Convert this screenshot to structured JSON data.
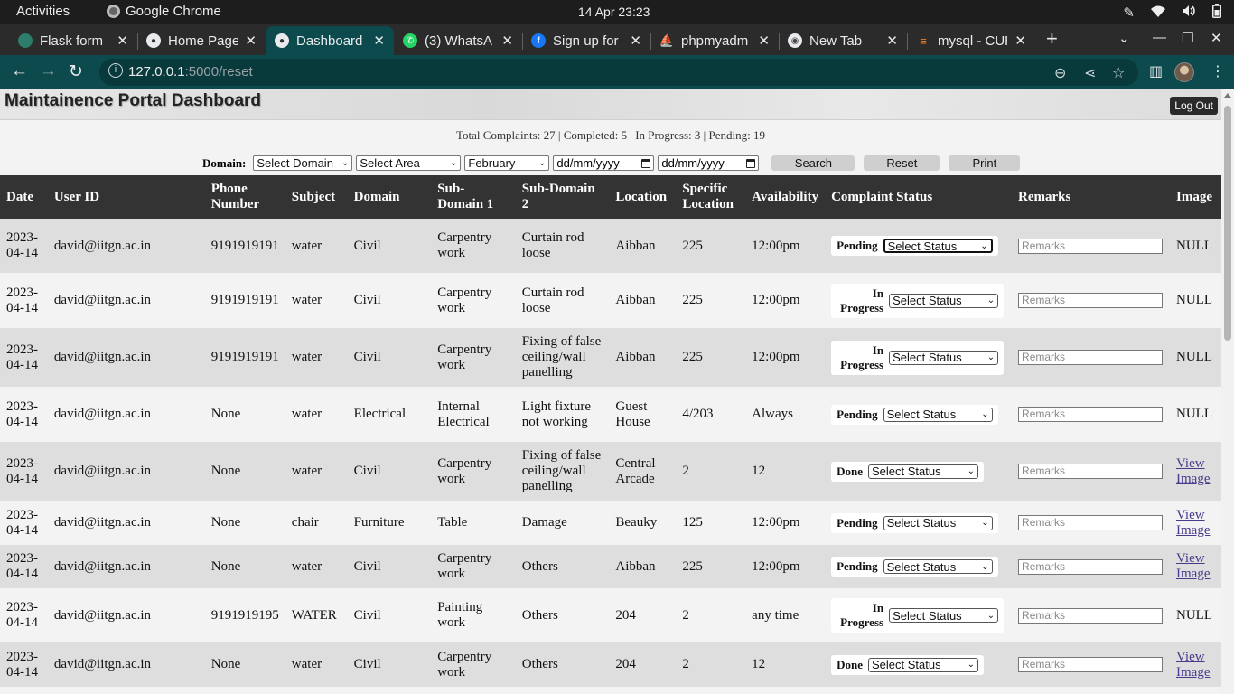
{
  "system": {
    "activities": "Activities",
    "app_name": "Google Chrome",
    "clock": "14 Apr  23:23"
  },
  "browser": {
    "tabs": [
      {
        "label": "Flask form",
        "icon": "flask-icon",
        "active": false
      },
      {
        "label": "Home Page",
        "icon": "globe-icon",
        "active": false
      },
      {
        "label": "Dashboard",
        "icon": "globe-icon",
        "active": true
      },
      {
        "label": "(3) WhatsA",
        "icon": "whatsapp-icon",
        "active": false
      },
      {
        "label": "Sign up for",
        "icon": "facebook-icon",
        "active": false
      },
      {
        "label": "phpmyadm",
        "icon": "phpmyadmin-icon",
        "active": false
      },
      {
        "label": "New Tab",
        "icon": "chrome-icon",
        "active": false
      },
      {
        "label": "mysql - CUR",
        "icon": "stackoverflow-icon",
        "active": false
      }
    ],
    "url_host": "127.0.0.1",
    "url_path": ":5000/reset"
  },
  "page": {
    "title": "Maintainence Portal Dashboard",
    "logout_label": "Log Out",
    "stats": "Total Complaints: 27 | Completed: 5 | In Progress: 3 | Pending: 19",
    "filters": {
      "label": "Domain:",
      "domain": "Select Domain",
      "area": "Select Area",
      "month": "February",
      "date_from": "dd/mm/yyyy",
      "date_to": "dd/mm/yyyy",
      "search_label": "Search",
      "reset_label": "Reset",
      "print_label": "Print"
    },
    "columns": [
      "Date",
      "User ID",
      "Phone Number",
      "Subject",
      "Domain",
      "Sub-Domain 1",
      "Sub-Domain 2",
      "Location",
      "Specific Location",
      "Availability",
      "Complaint Status",
      "Remarks",
      "Image"
    ],
    "status_select_placeholder": "Select Status",
    "remarks_placeholder": "Remarks",
    "view_image_label": "View Image",
    "rows": [
      {
        "date": "2023-04-14",
        "user": "david@iitgn.ac.in",
        "phone": "9191919191",
        "subject": "water",
        "domain": "Civil",
        "sub1": "Carpentry work",
        "sub2": "Curtain rod loose",
        "location": "Aibban",
        "specific": "225",
        "availability": "12:00pm",
        "status": "Pending",
        "image": "NULL"
      },
      {
        "date": "2023-04-14",
        "user": "david@iitgn.ac.in",
        "phone": "9191919191",
        "subject": "water",
        "domain": "Civil",
        "sub1": "Carpentry work",
        "sub2": "Curtain rod loose",
        "location": "Aibban",
        "specific": "225",
        "availability": "12:00pm",
        "status": "In Progress",
        "image": "NULL"
      },
      {
        "date": "2023-04-14",
        "user": "david@iitgn.ac.in",
        "phone": "9191919191",
        "subject": "water",
        "domain": "Civil",
        "sub1": "Carpentry work",
        "sub2": "Fixing of false ceiling/wall panelling",
        "location": "Aibban",
        "specific": "225",
        "availability": "12:00pm",
        "status": "In Progress",
        "image": "NULL"
      },
      {
        "date": "2023-04-14",
        "user": "david@iitgn.ac.in",
        "phone": "None",
        "subject": "water",
        "domain": "Electrical",
        "sub1": "Internal Electrical",
        "sub2": "Light fixture not working",
        "location": "Guest House",
        "specific": "4/203",
        "availability": "Always",
        "status": "Pending",
        "image": "NULL"
      },
      {
        "date": "2023-04-14",
        "user": "david@iitgn.ac.in",
        "phone": "None",
        "subject": "water",
        "domain": "Civil",
        "sub1": "Carpentry work",
        "sub2": "Fixing of false ceiling/wall panelling",
        "location": "Central Arcade",
        "specific": "2",
        "availability": "12",
        "status": "Done",
        "image": "View Image"
      },
      {
        "date": "2023-04-14",
        "user": "david@iitgn.ac.in",
        "phone": "None",
        "subject": "chair",
        "domain": "Furniture",
        "sub1": "Table",
        "sub2": "Damage",
        "location": "Beauky",
        "specific": "125",
        "availability": "12:00pm",
        "status": "Pending",
        "image": "View Image"
      },
      {
        "date": "2023-04-14",
        "user": "david@iitgn.ac.in",
        "phone": "None",
        "subject": "water",
        "domain": "Civil",
        "sub1": "Carpentry work",
        "sub2": "Others",
        "location": "Aibban",
        "specific": "225",
        "availability": "12:00pm",
        "status": "Pending",
        "image": "View Image"
      },
      {
        "date": "2023-04-14",
        "user": "david@iitgn.ac.in",
        "phone": "9191919195",
        "subject": "WATER",
        "domain": "Civil",
        "sub1": "Painting work",
        "sub2": "Others",
        "location": "204",
        "specific": "2",
        "availability": "any time",
        "status": "In Progress",
        "image": "NULL"
      },
      {
        "date": "2023-04-14",
        "user": "david@iitgn.ac.in",
        "phone": "None",
        "subject": "water",
        "domain": "Civil",
        "sub1": "Carpentry work",
        "sub2": "Others",
        "location": "204",
        "specific": "2",
        "availability": "12",
        "status": "Done",
        "image": "View Image"
      }
    ]
  }
}
